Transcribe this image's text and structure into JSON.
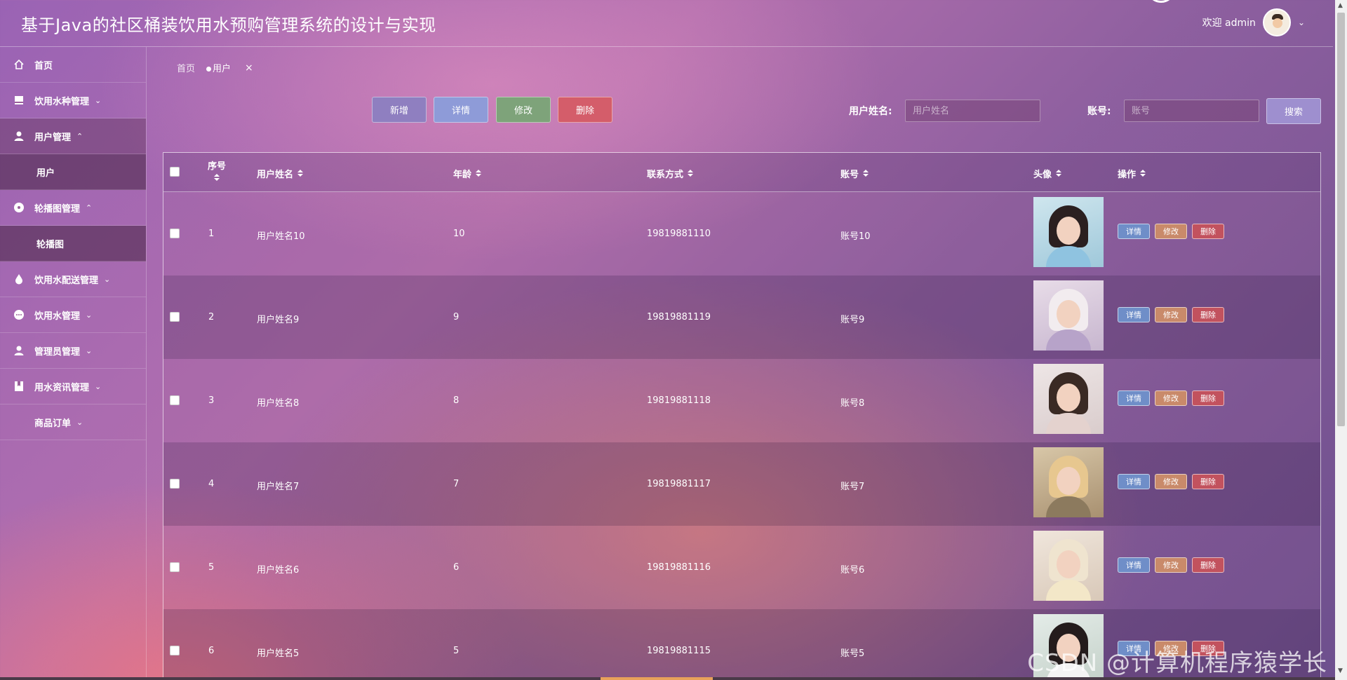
{
  "header": {
    "title": "基于Java的社区桶装饮用水预购管理系统的设计与实现",
    "welcome": "欢迎 admin"
  },
  "sidebar": {
    "items": [
      {
        "label": "首页",
        "icon": "home-icon"
      },
      {
        "label": "饮用水种管理",
        "icon": "box-icon"
      },
      {
        "label": "用户管理",
        "icon": "user-icon"
      },
      {
        "label": "用户"
      },
      {
        "label": "轮播图管理",
        "icon": "circle-icon"
      },
      {
        "label": "轮播图"
      },
      {
        "label": "饮用水配送管理",
        "icon": "drop-icon"
      },
      {
        "label": "饮用水管理",
        "icon": "chat-icon"
      },
      {
        "label": "管理员管理",
        "icon": "admin-icon"
      },
      {
        "label": "用水资讯管理",
        "icon": "bookmark-icon"
      },
      {
        "label": "商品订单"
      }
    ]
  },
  "breadcrumb": {
    "home": "首页",
    "current": "用户",
    "close": "×"
  },
  "toolbar": {
    "add": "新增",
    "detail": "详情",
    "edit": "修改",
    "delete": "删除"
  },
  "search": {
    "name_label": "用户姓名:",
    "name_placeholder": "用户姓名",
    "account_label": "账号:",
    "account_placeholder": "账号",
    "button": "搜索"
  },
  "table": {
    "headers": {
      "index": "序号",
      "name": "用户姓名",
      "age": "年龄",
      "phone": "联系方式",
      "account": "账号",
      "avatar": "头像",
      "ops": "操作"
    },
    "ops": {
      "detail": "详情",
      "edit": "修改",
      "delete": "删除"
    },
    "rows": [
      {
        "index": "1",
        "name": "用户姓名10",
        "age": "10",
        "phone": "19819881110",
        "account": "账号10"
      },
      {
        "index": "2",
        "name": "用户姓名9",
        "age": "9",
        "phone": "19819881119",
        "account": "账号9"
      },
      {
        "index": "3",
        "name": "用户姓名8",
        "age": "8",
        "phone": "19819881118",
        "account": "账号8"
      },
      {
        "index": "4",
        "name": "用户姓名7",
        "age": "7",
        "phone": "19819881117",
        "account": "账号7"
      },
      {
        "index": "5",
        "name": "用户姓名6",
        "age": "6",
        "phone": "19819881116",
        "account": "账号6"
      },
      {
        "index": "6",
        "name": "用户姓名5",
        "age": "5",
        "phone": "19819881115",
        "account": "账号5"
      }
    ]
  },
  "watermark": "CSDN @计算机程序猿学长",
  "colors": {
    "add": "#8f7fc0",
    "detail": "#8e9bd8",
    "edit": "#7ea37a",
    "delete": "#d45d6a",
    "op_detail": "#6f8ec8",
    "op_edit": "#c98a6a",
    "op_delete": "#c2525e"
  }
}
